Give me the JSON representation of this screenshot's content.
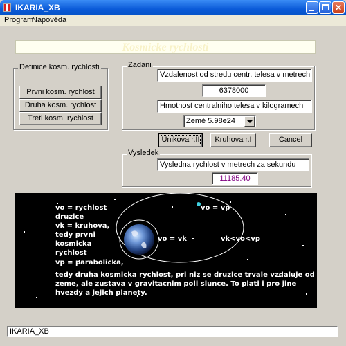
{
  "window": {
    "title": "IKARIA_XB"
  },
  "menu": {
    "items": [
      "Program",
      "Nápověda"
    ]
  },
  "banner": {
    "text": "Kosmicke rychlosti"
  },
  "definition_group": {
    "title": "Definice kosm. rychlosti",
    "buttons": [
      "Prvni kosm. rychlost",
      "Druha kosm. rychlost",
      "Treti kosm. rychlost"
    ]
  },
  "input_group": {
    "title": "Zadani",
    "distance_label": "Vzdalenost od stredu centr. telesa v metrech.",
    "distance_value": "6378000",
    "mass_label": "Hmotnost centralniho telesa v kilogramech",
    "mass_selected": "Země 5.98e24"
  },
  "actions": {
    "escape": "Unikova r.II",
    "circular": "Kruhova r.I",
    "cancel": "Cancel"
  },
  "result_group": {
    "title": "Vysledek",
    "label": "Vysledna rychlost v metrech za sekundu",
    "value": "11185.40"
  },
  "diagram": {
    "legend_vo": "vo = rychlost",
    "legend_druzice": "druzice",
    "legend_vk": "vk = kruhova,",
    "legend_tedy": "tedy prvni",
    "legend_kosmicka": "kosmicka",
    "legend_rychlost": "rychlost",
    "legend_vp": "vp = parabolicka,",
    "label_vo_vp": "vo = vp",
    "label_vo_vk": "vo = vk",
    "label_vk_vo_vp": "vk<vo<vp",
    "desc_1": "tedy druha kosmicka rychlost, pri niz se druzice trvale vzdaluje od",
    "desc_2": "zeme, ale zustava v gravitacnim poli slunce. To plati i pro jine",
    "desc_3": "hvezdy a jejich planety."
  },
  "status": {
    "text": "IKARIA_XB"
  },
  "colors": {
    "result_value": "#800080",
    "satellite": "#40d0e0",
    "titlebar": "#0a5ad8"
  }
}
